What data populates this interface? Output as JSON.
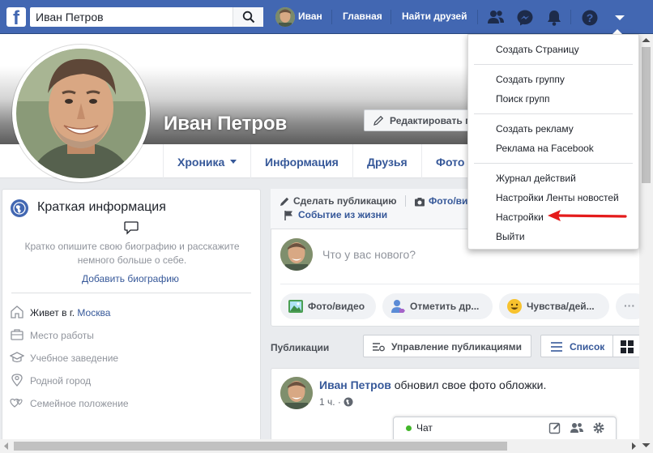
{
  "topbar": {
    "logo": "f",
    "search_value": "Иван Петров",
    "user_name": "Иван",
    "home": "Главная",
    "find_friends": "Найти друзей",
    "icons": [
      "friend-requests-icon",
      "messenger-icon",
      "notifications-icon",
      "help-icon",
      "chevron-down-icon"
    ]
  },
  "profile": {
    "name": "Иван Петров",
    "edit_button": "Редактировать п",
    "tabs": [
      "Хроника",
      "Информация",
      "Друзья",
      "Фото"
    ]
  },
  "intro": {
    "title": "Краткая информация",
    "bio_prompt": "Кратко опишите свою биографию и расскажите немного больше о себе.",
    "add_bio": "Добавить биографию",
    "lives_in_prefix": "Живет в г. ",
    "lives_in_city": "Москва",
    "work": "Место работы",
    "education": "Учебное заведение",
    "hometown": "Родной город",
    "relationship": "Семейное положение"
  },
  "composer": {
    "tab_post": "Сделать публикацию",
    "tab_photo": "Фото/ви",
    "tab_life_event": "Событие из жизни",
    "placeholder": "Что у вас нового?",
    "photo_video": "Фото/видео",
    "tag_friends": "Отметить др...",
    "feeling": "Чувства/дей...",
    "more": "···"
  },
  "posts": {
    "label": "Публикации",
    "manage": "Управление публикациями",
    "list_view": "Список",
    "post_author": "Иван Петров",
    "post_action": " обновил свое фото обложки.",
    "post_time": "1 ч. ·"
  },
  "chat": {
    "label": "Чат"
  },
  "menu": {
    "items": [
      "Создать Страницу",
      "Создать группу",
      "Поиск групп",
      "Создать рекламу",
      "Реклама на Facebook",
      "Журнал действий",
      "Настройки Ленты новостей",
      "Настройки",
      "Выйти"
    ]
  },
  "colors": {
    "brand": "#4267b2",
    "link": "#365899",
    "annotation_arrow": "#e41b1b",
    "online": "#42b72a"
  }
}
